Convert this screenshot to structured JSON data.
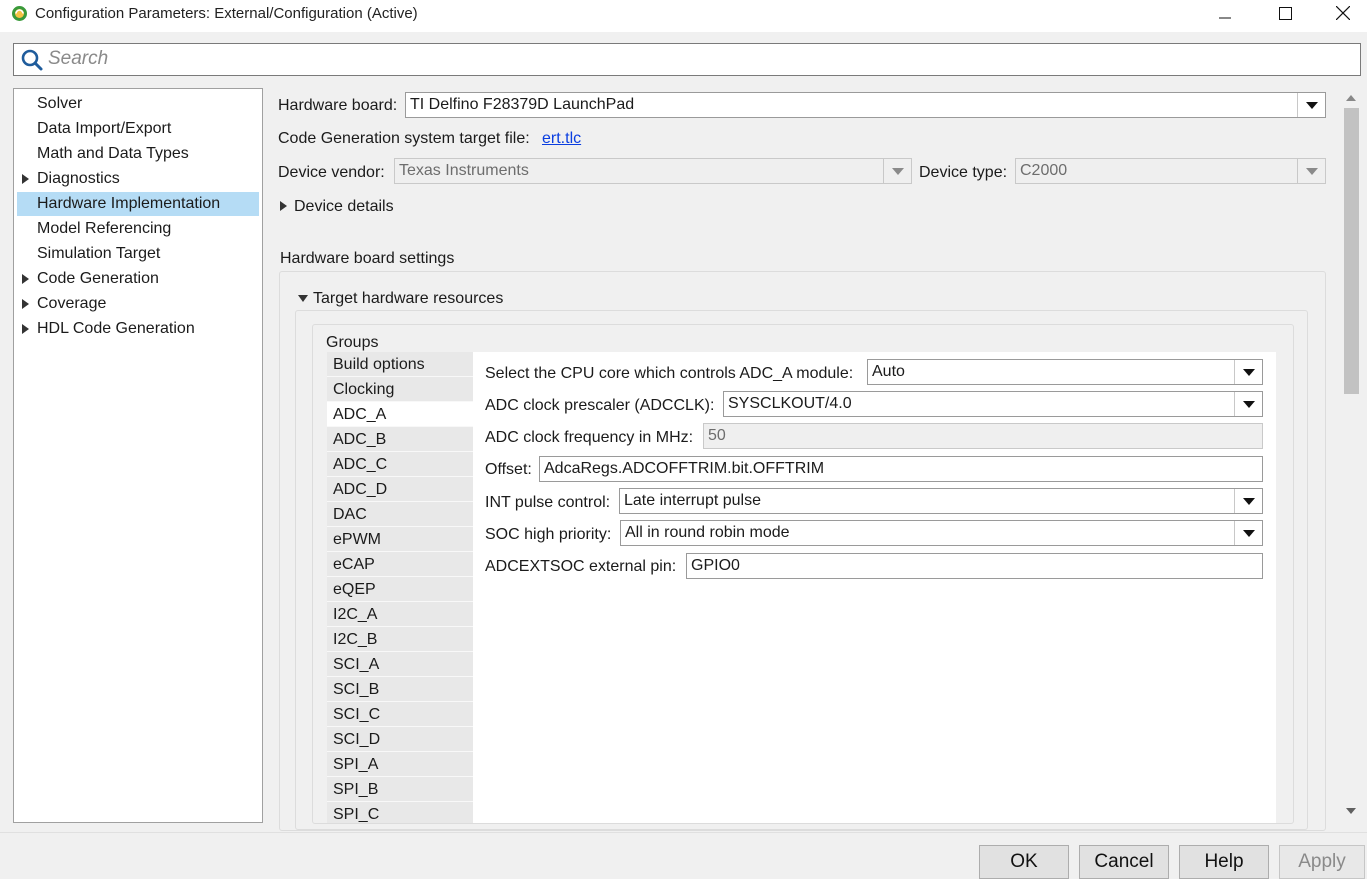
{
  "window": {
    "title": "Configuration Parameters: External/Configuration (Active)",
    "icon": "simulink-logo-icon"
  },
  "search": {
    "placeholder": "Search"
  },
  "tree": {
    "items": [
      {
        "label": "Solver",
        "expandable": false
      },
      {
        "label": "Data Import/Export",
        "expandable": false
      },
      {
        "label": "Math and Data Types",
        "expandable": false
      },
      {
        "label": "Diagnostics",
        "expandable": true
      },
      {
        "label": "Hardware Implementation",
        "expandable": false,
        "selected": true
      },
      {
        "label": "Model Referencing",
        "expandable": false
      },
      {
        "label": "Simulation Target",
        "expandable": false
      },
      {
        "label": "Code Generation",
        "expandable": true
      },
      {
        "label": "Coverage",
        "expandable": true
      },
      {
        "label": "HDL Code Generation",
        "expandable": true
      }
    ]
  },
  "hardware": {
    "board_label": "Hardware board:",
    "board_value": "TI Delfino F28379D LaunchPad",
    "target_file_label": "Code Generation system target file:",
    "target_file_link": "ert.tlc",
    "vendor_label": "Device vendor:",
    "vendor_value": "Texas Instruments",
    "type_label": "Device type:",
    "type_value": "C2000",
    "device_details": "Device details",
    "board_settings_title": "Hardware board settings",
    "target_resources": "Target hardware resources",
    "groups_label": "Groups"
  },
  "groups": [
    "Build options",
    "Clocking",
    "ADC_A",
    "ADC_B",
    "ADC_C",
    "ADC_D",
    "DAC",
    "ePWM",
    "eCAP",
    "eQEP",
    "I2C_A",
    "I2C_B",
    "SCI_A",
    "SCI_B",
    "SCI_C",
    "SCI_D",
    "SPI_A",
    "SPI_B",
    "SPI_C"
  ],
  "selected_group": "ADC_A",
  "adc": {
    "cpu_core_label": "Select the CPU core which controls ADC_A module:",
    "cpu_core_value": "Auto",
    "prescaler_label": "ADC clock prescaler (ADCCLK):",
    "prescaler_value": "SYSCLKOUT/4.0",
    "freq_label": "ADC clock frequency in MHz:",
    "freq_value": "50",
    "offset_label": "Offset:",
    "offset_value": "AdcaRegs.ADCOFFTRIM.bit.OFFTRIM",
    "int_pulse_label": "INT pulse control:",
    "int_pulse_value": "Late interrupt pulse",
    "soc_label": "SOC high priority:",
    "soc_value": "All in round robin mode",
    "extsoc_label": "ADCEXTSOC external pin:",
    "extsoc_value": "GPIO0"
  },
  "buttons": {
    "ok": "OK",
    "cancel": "Cancel",
    "help": "Help",
    "apply": "Apply"
  },
  "colors": {
    "selection": "#b5dcf5",
    "link": "#0a3ee0"
  }
}
